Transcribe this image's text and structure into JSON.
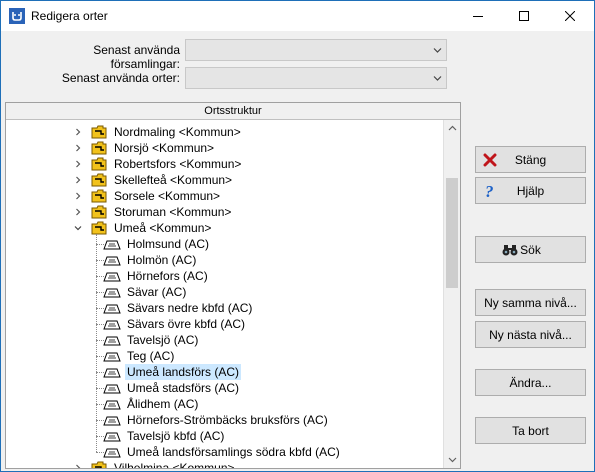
{
  "window": {
    "title": "Redigera orter",
    "minimize": "minimize",
    "maximize": "maximize",
    "close": "close"
  },
  "fields": {
    "forsamlingar_label": "Senast använda församlingar:",
    "orter_label": "Senast använda orter:",
    "forsamlingar_value": "",
    "orter_value": ""
  },
  "tree": {
    "header": "Ortsstruktur",
    "kommuner": [
      {
        "label": "Nordmaling <Kommun>",
        "expanded": false
      },
      {
        "label": "Norsjö <Kommun>",
        "expanded": false
      },
      {
        "label": "Robertsfors <Kommun>",
        "expanded": false
      },
      {
        "label": "Skellefteå <Kommun>",
        "expanded": false
      },
      {
        "label": "Sorsele <Kommun>",
        "expanded": false
      },
      {
        "label": "Storuman <Kommun>",
        "expanded": false
      },
      {
        "label": "Umeå <Kommun>",
        "expanded": true
      }
    ],
    "children": [
      {
        "label": "Holmsund (AC)",
        "selected": false
      },
      {
        "label": "Holmön (AC)",
        "selected": false
      },
      {
        "label": "Hörnefors (AC)",
        "selected": false
      },
      {
        "label": "Sävar (AC)",
        "selected": false
      },
      {
        "label": "Sävars nedre kbfd (AC)",
        "selected": false
      },
      {
        "label": "Sävars övre kbfd (AC)",
        "selected": false
      },
      {
        "label": "Tavelsjö (AC)",
        "selected": false
      },
      {
        "label": "Teg (AC)",
        "selected": false
      },
      {
        "label": "Umeå landsförs (AC)",
        "selected": true
      },
      {
        "label": "Umeå stadsförs (AC)",
        "selected": false
      },
      {
        "label": "Ålidhem (AC)",
        "selected": false
      },
      {
        "label": "Hörnefors-Strömbäcks bruksförs (AC)",
        "selected": false
      },
      {
        "label": "Tavelsjö kbfd (AC)",
        "selected": false
      },
      {
        "label": "Umeå landsförsamlings södra kbfd (AC)",
        "selected": false
      }
    ],
    "last": {
      "label": "Vilhelmina <Kommun>"
    }
  },
  "buttons": {
    "stang": "Stäng",
    "hjalp": "Hjälp",
    "sok": "Sök",
    "ny_samma": "Ny samma nivå...",
    "ny_nasta": "Ny nästa nivå...",
    "andra": "Ändra...",
    "ta_bort": "Ta bort"
  },
  "colors": {
    "folder": "#f2c21b",
    "selection": "#cce8ff",
    "close_icon": "#c0151b",
    "help_icon": "#1e62c8"
  }
}
